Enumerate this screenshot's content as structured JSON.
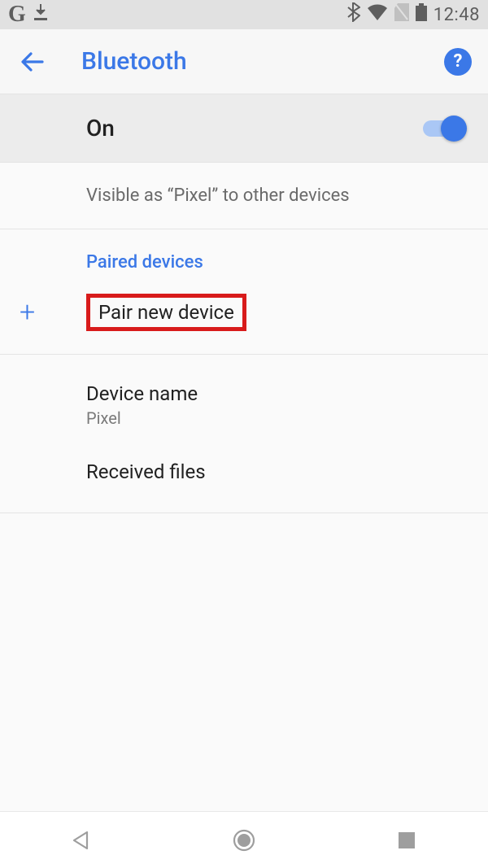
{
  "statusBar": {
    "clock": "12:48"
  },
  "appBar": {
    "title": "Bluetooth"
  },
  "toggle": {
    "label": "On",
    "enabled": true
  },
  "visibility": {
    "text": "Visible as “Pixel” to other devices"
  },
  "sections": {
    "pairedHeader": "Paired devices",
    "pairNew": "Pair new device",
    "deviceName": {
      "label": "Device name",
      "value": "Pixel"
    },
    "receivedFiles": "Received files"
  }
}
